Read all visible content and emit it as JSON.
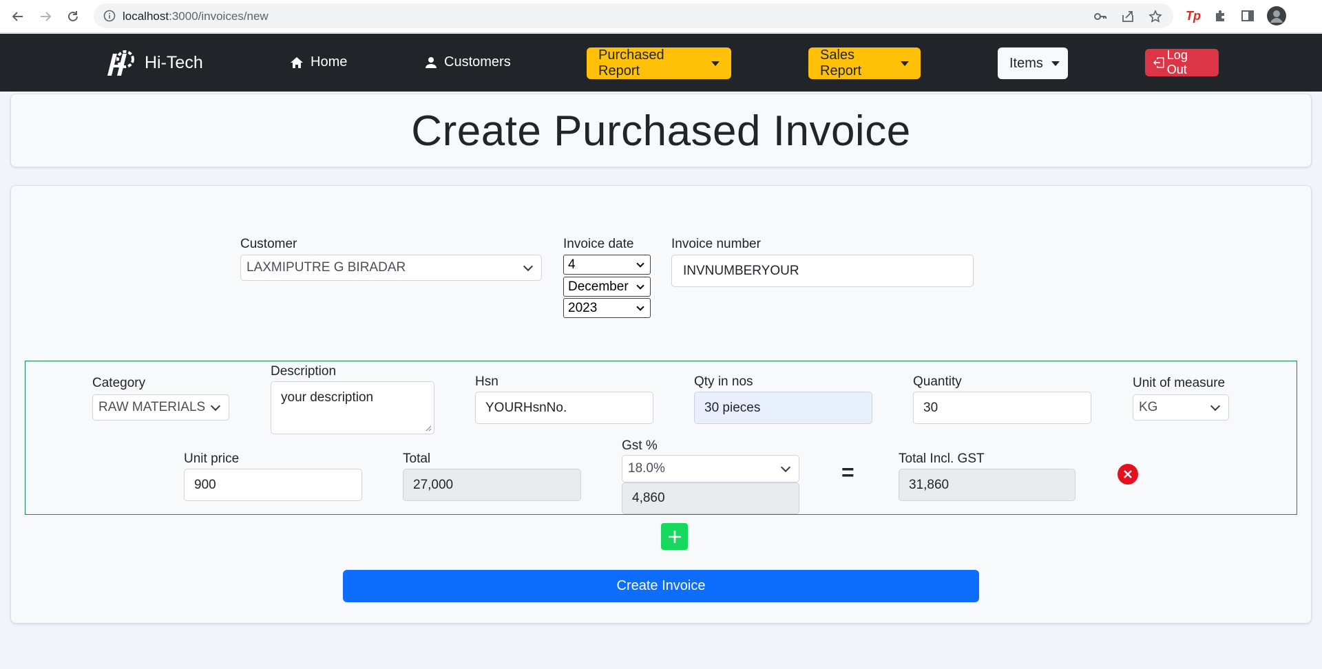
{
  "browser": {
    "url_host": "localhost",
    "url_path": ":3000/invoices/new"
  },
  "navbar": {
    "brand": "Hi-Tech",
    "home_label": "Home",
    "customers_label": "Customers",
    "purchased_report_label": "Purchased Report",
    "sales_report_label": "Sales Report",
    "items_label": "Items",
    "logout_label": "Log Out"
  },
  "page": {
    "title": "Create Purchased Invoice"
  },
  "header_form": {
    "customer_label": "Customer",
    "customer_value": "LAXMIPUTRE G BIRADAR",
    "invoice_date_label": "Invoice date",
    "day_value": "4",
    "month_value": "December",
    "year_value": "2023",
    "invoice_number_label": "Invoice number",
    "invoice_number_value": "INVNUMBERYOUR"
  },
  "item": {
    "category_label": "Category",
    "category_value": "RAW MATERIALS",
    "description_label": "Description",
    "description_value": "your description",
    "hsn_label": "Hsn",
    "hsn_value": "YOURHsnNo.",
    "qty_nos_label": "Qty in nos",
    "qty_nos_value": "30 pieces",
    "quantity_label": "Quantity",
    "quantity_value": "30",
    "uom_label": "Unit of measure",
    "uom_value": "KG",
    "unit_price_label": "Unit price",
    "unit_price_value": "900",
    "total_label": "Total",
    "total_value": "27,000",
    "gst_label": "Gst %",
    "gst_value": "18.0%",
    "gst_amount_value": "4,860",
    "equals": "=",
    "total_incl_label": "Total Incl. GST",
    "total_incl_value": "31,860"
  },
  "actions": {
    "create_label": "Create Invoice"
  },
  "colors": {
    "navbar_bg": "#212529",
    "warning": "#ffc107",
    "danger": "#dc3545",
    "primary": "#0d6efd",
    "success_border": "#198754",
    "add_button": "#16d85c"
  }
}
